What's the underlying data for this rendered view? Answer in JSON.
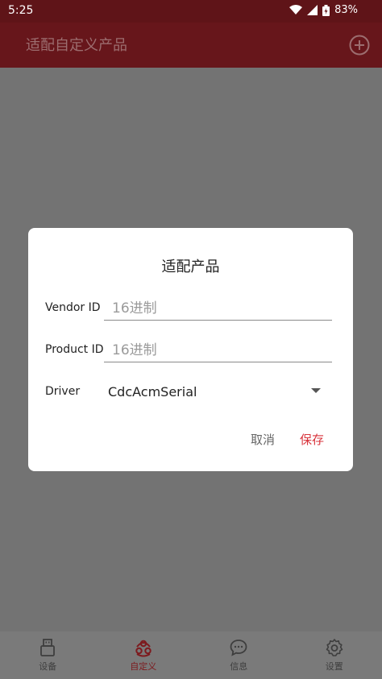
{
  "status_bar": {
    "time": "5:25",
    "battery": "83%"
  },
  "app_bar": {
    "title": "适配自定义产品"
  },
  "dialog": {
    "title": "适配产品",
    "vendor_label": "Vendor ID",
    "vendor_placeholder": "16进制",
    "product_label": "Product ID",
    "product_placeholder": "16进制",
    "driver_label": "Driver",
    "driver_value": "CdcAcmSerial",
    "cancel_label": "取消",
    "save_label": "保存"
  },
  "bottom_nav": {
    "items": [
      {
        "label": "设备",
        "icon": "usb-device-icon"
      },
      {
        "label": "自定义",
        "icon": "custom-icon"
      },
      {
        "label": "信息",
        "icon": "chat-bubble-icon"
      },
      {
        "label": "设置",
        "icon": "gear-icon"
      }
    ],
    "active_index": 1
  },
  "colors": {
    "status_bar": "#5f1418",
    "app_bar": "#67161b",
    "accent_save": "#d8343c",
    "scrim": "#737373"
  }
}
